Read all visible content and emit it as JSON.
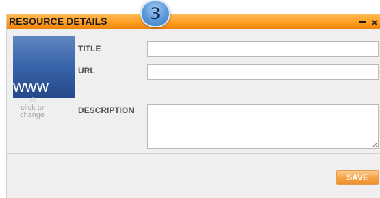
{
  "window": {
    "title": "RESOURCE DETAILS",
    "step_number": "3",
    "minimize_icon": "minimize-icon",
    "close_glyph": "×"
  },
  "thumbnail": {
    "text": "www",
    "change_hint": "click to change"
  },
  "fields": {
    "title_label": "TITLE",
    "title_value": "",
    "url_label": "URL",
    "url_value": "",
    "description_label": "DESCRIPTION",
    "description_value": ""
  },
  "actions": {
    "save_label": "SAVE"
  },
  "colors": {
    "titlebar": "#ff9e24",
    "badge": "#5b98d8",
    "thumbnail": "#3a66ab",
    "save_button": "#f7a246"
  }
}
